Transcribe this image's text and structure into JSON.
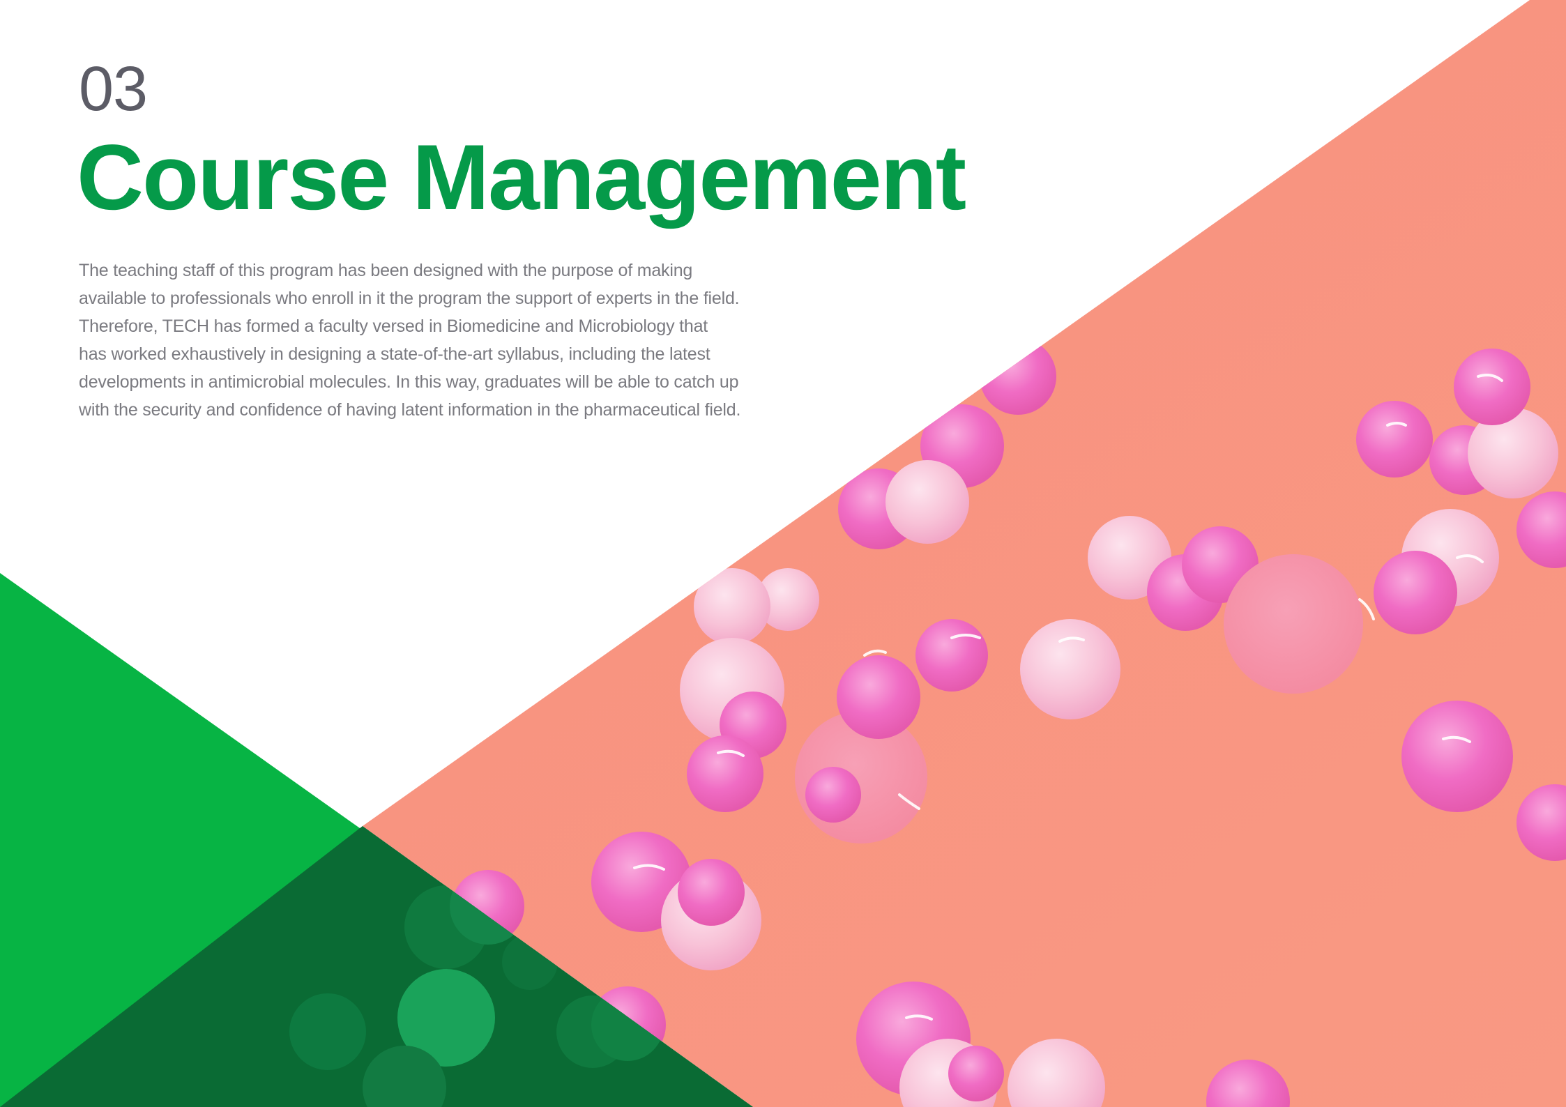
{
  "header": {
    "section_number": "03",
    "section_title": "Course Management"
  },
  "intro": {
    "lines": [
      "The teaching staff of this program has been designed with the purpose of making",
      "available to professionals who enroll in it the program the support of experts in the field.",
      "Therefore, TECH  has formed a faculty versed in Biomedicine and Microbiology that",
      "has worked exhaustively in designing a state-of-the-art syllabus, including the latest",
      "developments in antimicrobial molecules. In this way, graduates will be able to catch up",
      "with the security and confidence of having latent information in the pharmaceutical field."
    ]
  },
  "decor": {
    "photo_subject": "pink bacterial colonies on agar plate",
    "colors": {
      "title_green": "#059a49",
      "number_gray": "#5c5c66",
      "body_gray": "#7a7a80",
      "green_panel": "#07b444",
      "dark_green_overlap": "#0a6b34",
      "agar_salmon": "#f7917d",
      "colony_pink": "#f06cbf",
      "colony_light": "#f7c8da"
    }
  }
}
